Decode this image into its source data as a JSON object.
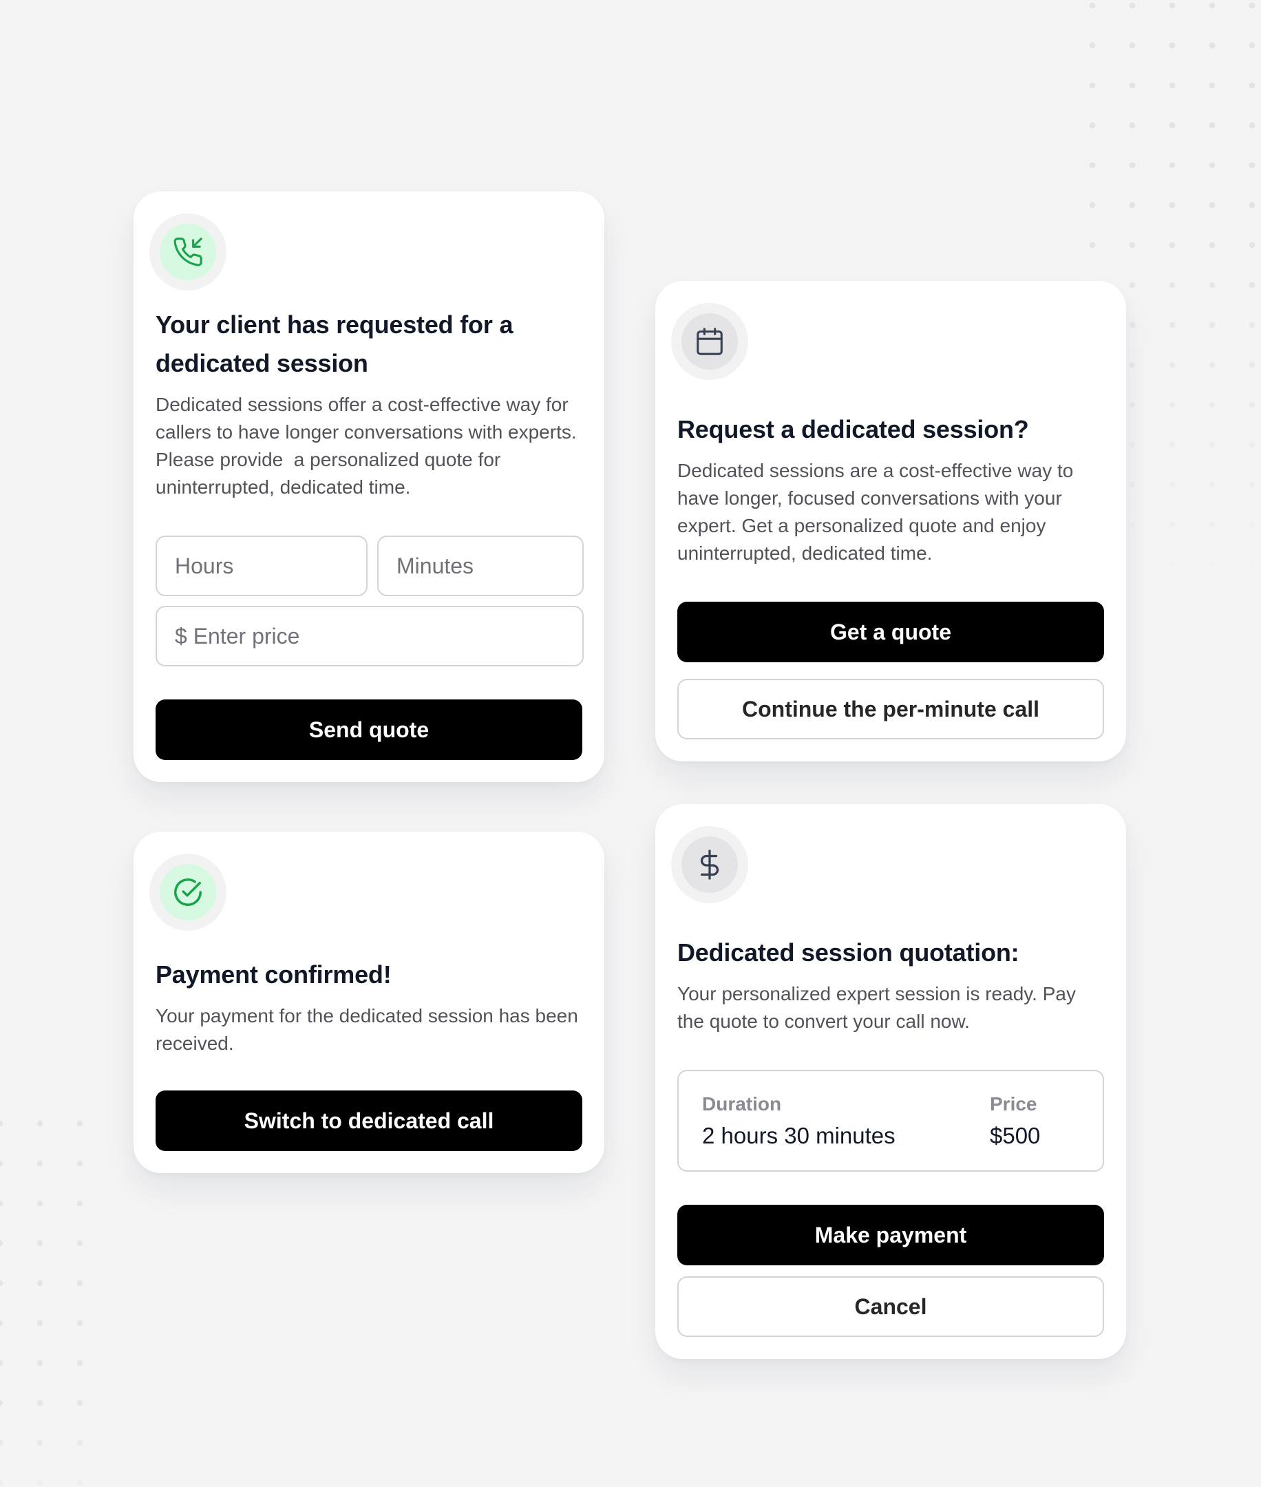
{
  "colors": {
    "background": "#f4f4f5",
    "card": "#ffffff",
    "primary_button": "#000000",
    "success_icon_bg": "#d7f8e1",
    "success_icon": "#16a34a"
  },
  "request_card": {
    "icon": "incoming-call-icon",
    "title": "Your client has requested for a dedicated session",
    "description": "Dedicated sessions offer a cost-effective way for callers to have longer conversations with experts. Please provide  a personalized quote for uninterrupted, dedicated time.",
    "hours_placeholder": "Hours",
    "minutes_placeholder": "Minutes",
    "price_placeholder": "$ Enter price",
    "submit_label": "Send quote"
  },
  "offer_card": {
    "icon": "calendar-icon",
    "title": "Request a dedicated session?",
    "description": "Dedicated sessions are a cost-effective way to have longer, focused conversations with your expert. Get a personalized quote and enjoy uninterrupted, dedicated time.",
    "primary_label": "Get a quote",
    "secondary_label": "Continue the per-minute call"
  },
  "confirmed_card": {
    "icon": "check-circle-icon",
    "title": "Payment confirmed!",
    "description": "Your payment for the dedicated session has been received.",
    "button_label": "Switch to dedicated call"
  },
  "quotation_card": {
    "icon": "dollar-icon",
    "title": "Dedicated session quotation:",
    "description": "Your personalized expert session is ready. Pay the quote to convert your call now.",
    "duration_label": "Duration",
    "duration_value": "2 hours 30 minutes",
    "price_label": "Price",
    "price_value": "$500",
    "primary_label": "Make payment",
    "secondary_label": "Cancel"
  }
}
